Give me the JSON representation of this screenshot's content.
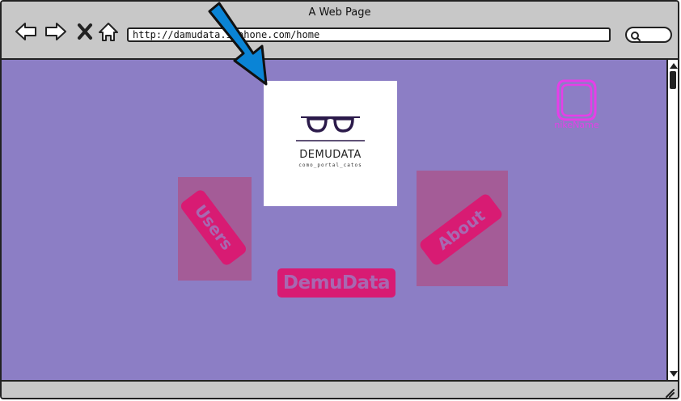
{
  "window": {
    "title": "A Web Page"
  },
  "toolbar": {
    "back_icon": "back-arrow-icon",
    "forward_icon": "forward-arrow-icon",
    "stop_icon": "close-icon",
    "home_icon": "home-icon",
    "url": "http://damudata.iaphone.com/home",
    "search_icon": "search-icon"
  },
  "page": {
    "background": "#8c7ec5",
    "logo": {
      "icon": "glasses-icon",
      "name": "DEMUDATA",
      "tagline": "como_portal_catos"
    },
    "users_button": "Users",
    "about_button": "About",
    "brand_button": "DemuData",
    "profile": {
      "avatar_icon": "avatar-icon",
      "name": "nikeName"
    },
    "accent_color": "#d81b73",
    "tile_color": "#a45c97",
    "profile_color": "#e63ee8",
    "annotation_icon": "pointer-arrow-icon"
  }
}
